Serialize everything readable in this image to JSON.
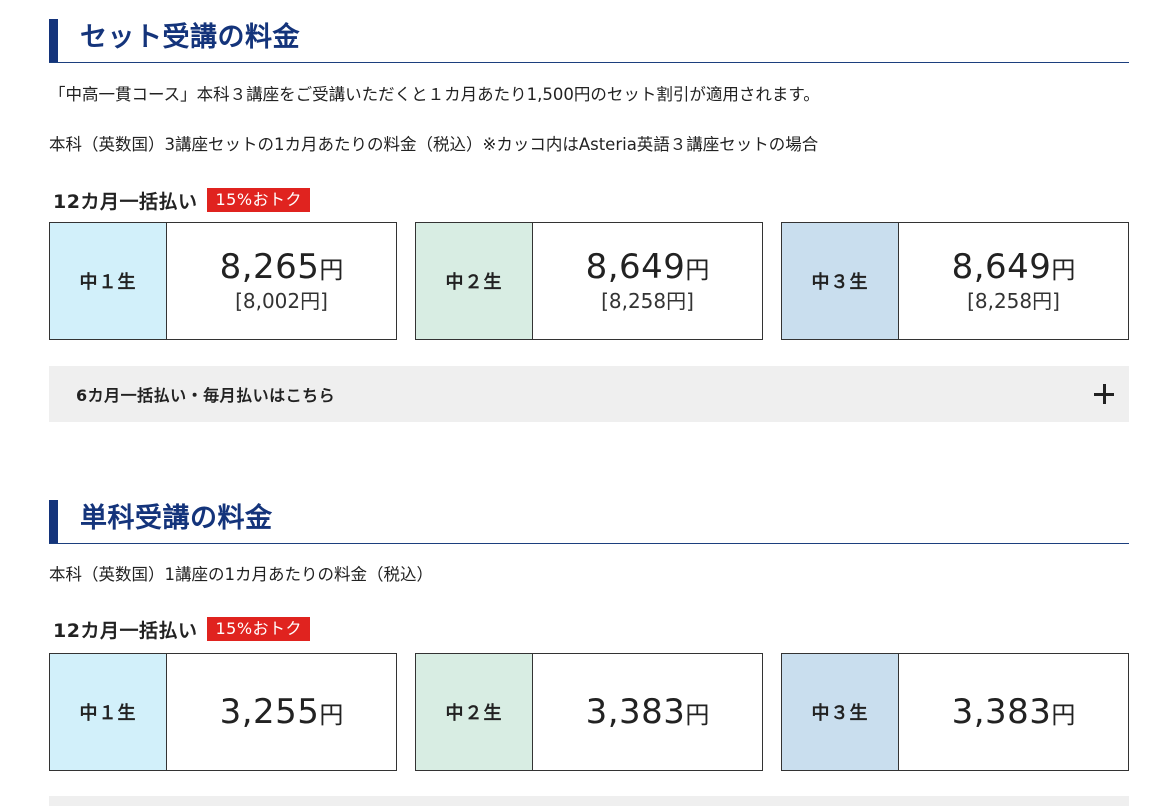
{
  "set_section": {
    "title": "セット受講の料金",
    "intro": "「中高一貫コース」本科３講座をご受講いただくと１カ月あたり1,500円のセット割引が適用されます。",
    "note": "本科（英数国）3講座セットの1カ月あたりの料金（税込）※カッコ内はAsteria英語３講座セットの場合",
    "plan_label": "12カ月一括払い",
    "badge": "15%おトク",
    "cards": [
      {
        "grade": "中１生",
        "price": "8,265",
        "unit": "円",
        "sub_price": "[8,002円]",
        "color": "#d2f0fa"
      },
      {
        "grade": "中２生",
        "price": "8,649",
        "unit": "円",
        "sub_price": "[8,258円]",
        "color": "#d8ede3"
      },
      {
        "grade": "中３生",
        "price": "8,649",
        "unit": "円",
        "sub_price": "[8,258円]",
        "color": "#c9deee"
      }
    ],
    "accordion_label": "6カ月一括払い・毎月払いはこちら"
  },
  "single_section": {
    "title": "単科受講の料金",
    "note": "本科（英数国）1講座の1カ月あたりの料金（税込）",
    "plan_label": "12カ月一括払い",
    "badge": "15%おトク",
    "cards": [
      {
        "grade": "中１生",
        "price": "3,255",
        "unit": "円",
        "color": "#d2f0fa"
      },
      {
        "grade": "中２生",
        "price": "3,383",
        "unit": "円",
        "color": "#d8ede3"
      },
      {
        "grade": "中３生",
        "price": "3,383",
        "unit": "円",
        "color": "#c9deee"
      }
    ]
  },
  "icons": {
    "accordion_toggle": "plus-icon"
  }
}
